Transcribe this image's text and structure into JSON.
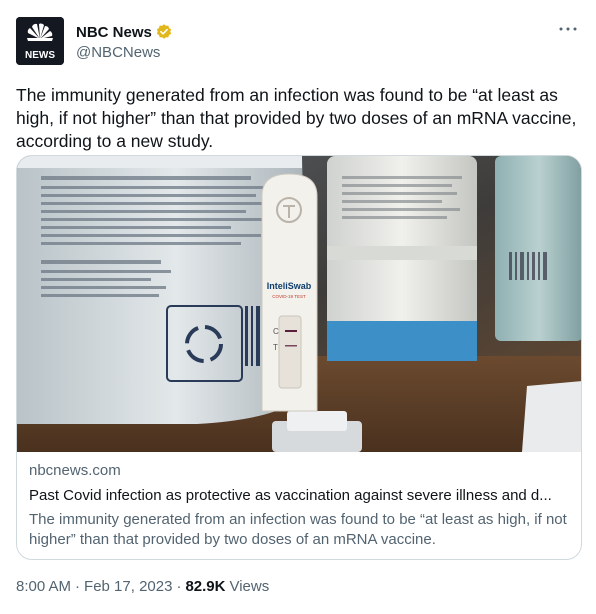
{
  "author": {
    "display_name": "NBC News",
    "handle": "@NBCNews",
    "verified": true,
    "avatar_text": "NEWS",
    "verified_color": "#e2b719"
  },
  "tweet": {
    "text": "The immunity generated from an infection was found to be “at least as high, if not higher” than that provided by two doses of an mRNA vaccine, according to a new study."
  },
  "card": {
    "image_text": {
      "brand": "InteliSwab",
      "subtitle": "COVID-19 TEST",
      "c_line": "C",
      "t_line": "T"
    },
    "domain": "nbcnews.com",
    "title": "Past Covid infection as protective as vaccination against severe illness and d...",
    "description": "The immunity generated from an infection was found to be “at least as high, if not higher” than that provided by two doses of an mRNA vaccine."
  },
  "meta": {
    "time": "8:00 AM",
    "separator": "·",
    "date": "Feb 17, 2023",
    "views_count": "82.9K",
    "views_label": "Views"
  },
  "icons": {
    "more": "more-options-icon",
    "verified": "verified-badge-icon",
    "logo": "nbc-peacock-logo"
  }
}
